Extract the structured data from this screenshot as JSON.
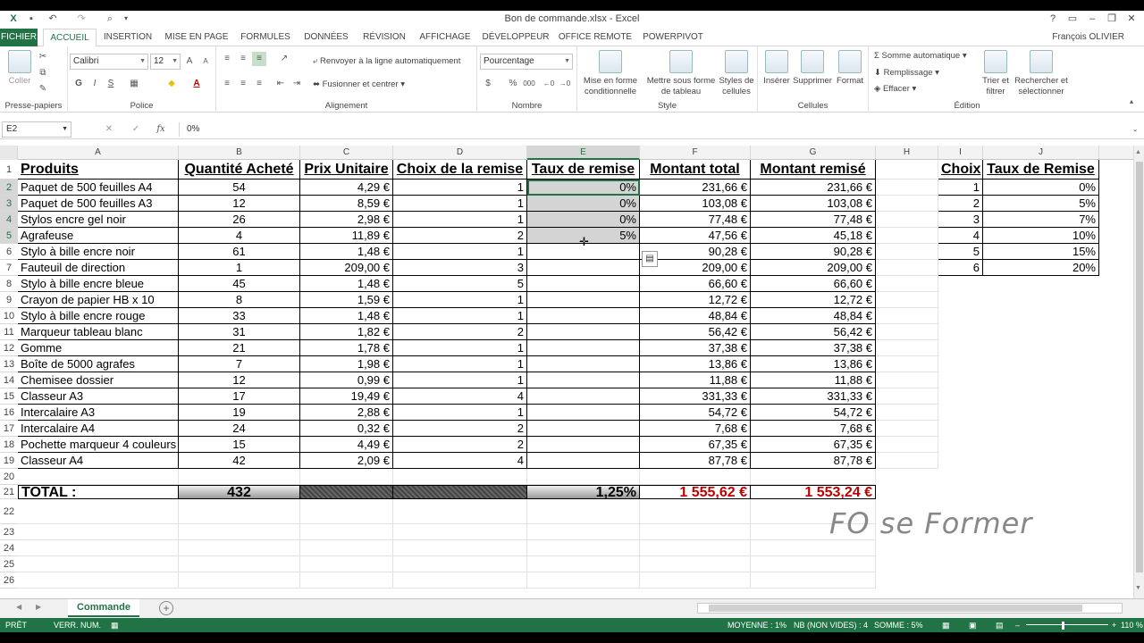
{
  "window": {
    "title": "Bon de commande.xlsx - Excel",
    "user": "François OLIVIER"
  },
  "tabs": [
    "FICHIER",
    "ACCUEIL",
    "INSERTION",
    "MISE EN PAGE",
    "FORMULES",
    "DONNÉES",
    "RÉVISION",
    "AFFICHAGE",
    "DÉVELOPPEUR",
    "OFFICE REMOTE",
    "POWERPIVOT"
  ],
  "ribbon": {
    "clipboard": {
      "label": "Presse-papiers",
      "paste": "Coller"
    },
    "font": {
      "label": "Police",
      "name": "Calibri",
      "size": "12",
      "bold": "G",
      "italic": "I",
      "underline": "S"
    },
    "align": {
      "label": "Alignement",
      "wrap": "Renvoyer à la ligne automatiquement",
      "merge": "Fusionner et centrer"
    },
    "number": {
      "label": "Nombre",
      "format": "Pourcentage",
      "percent": "%",
      "thousands": "000"
    },
    "style": {
      "label": "Style",
      "cond": "Mise en forme conditionnelle",
      "table": "Mettre sous forme de tableau",
      "cellstyles": "Styles de cellules"
    },
    "cells": {
      "label": "Cellules",
      "insert": "Insérer",
      "delete": "Supprimer",
      "format": "Format"
    },
    "edit": {
      "label": "Édition",
      "autosum": "Somme automatique",
      "fill": "Remplissage",
      "clear": "Effacer",
      "sort": "Trier et filtrer",
      "find": "Rechercher et sélectionner"
    }
  },
  "formula_bar": {
    "name_box": "E2",
    "fx": "fx",
    "value": "0%"
  },
  "columns": [
    "A",
    "B",
    "C",
    "D",
    "E",
    "F",
    "G",
    "H",
    "I",
    "J"
  ],
  "headers": {
    "A": "Produits",
    "B": "Quantité Acheté",
    "C": "Prix Unitaire",
    "D": "Choix de la remise",
    "E": "Taux de remise",
    "F": "Montant total",
    "G": "Montant remisé",
    "I": "Choix",
    "J": "Taux de Remise"
  },
  "rows": [
    [
      "Paquet de 500 feuilles A4",
      "54",
      "4,29 €",
      "1",
      "0%",
      "231,66 €",
      "231,66 €"
    ],
    [
      "Paquet de 500 feuilles A3",
      "12",
      "8,59 €",
      "1",
      "0%",
      "103,08 €",
      "103,08 €"
    ],
    [
      "Stylos encre gel noir",
      "26",
      "2,98 €",
      "1",
      "0%",
      "77,48 €",
      "77,48 €"
    ],
    [
      "Agrafeuse",
      "4",
      "11,89 €",
      "2",
      "5%",
      "47,56 €",
      "45,18 €"
    ],
    [
      "Stylo à bille encre noir",
      "61",
      "1,48 €",
      "1",
      "",
      "90,28 €",
      "90,28 €"
    ],
    [
      "Fauteuil de direction",
      "1",
      "209,00 €",
      "3",
      "",
      "209,00 €",
      "209,00 €"
    ],
    [
      "Stylo à bille encre bleue",
      "45",
      "1,48 €",
      "5",
      "",
      "66,60 €",
      "66,60 €"
    ],
    [
      "Crayon de papier HB x 10",
      "8",
      "1,59 €",
      "1",
      "",
      "12,72 €",
      "12,72 €"
    ],
    [
      "Stylo à bille encre rouge",
      "33",
      "1,48 €",
      "1",
      "",
      "48,84 €",
      "48,84 €"
    ],
    [
      "Marqueur tableau blanc",
      "31",
      "1,82 €",
      "2",
      "",
      "56,42 €",
      "56,42 €"
    ],
    [
      "Gomme",
      "21",
      "1,78 €",
      "1",
      "",
      "37,38 €",
      "37,38 €"
    ],
    [
      "Boîte de 5000 agrafes",
      "7",
      "1,98 €",
      "1",
      "",
      "13,86 €",
      "13,86 €"
    ],
    [
      "Chemisee dossier",
      "12",
      "0,99 €",
      "1",
      "",
      "11,88 €",
      "11,88 €"
    ],
    [
      "Classeur A3",
      "17",
      "19,49 €",
      "4",
      "",
      "331,33 €",
      "331,33 €"
    ],
    [
      "Intercalaire A3",
      "19",
      "2,88 €",
      "1",
      "",
      "54,72 €",
      "54,72 €"
    ],
    [
      "Intercalaire A4",
      "24",
      "0,32 €",
      "2",
      "",
      "7,68 €",
      "7,68 €"
    ],
    [
      "Pochette marqueur 4 couleurs",
      "15",
      "4,49 €",
      "2",
      "",
      "67,35 €",
      "67,35 €"
    ],
    [
      "Classeur A4",
      "42",
      "2,09 €",
      "4",
      "",
      "87,78 €",
      "87,78 €"
    ]
  ],
  "lookup": [
    [
      "1",
      "0%"
    ],
    [
      "2",
      "5%"
    ],
    [
      "3",
      "7%"
    ],
    [
      "4",
      "10%"
    ],
    [
      "5",
      "15%"
    ],
    [
      "6",
      "20%"
    ]
  ],
  "total": {
    "label": "TOTAL :",
    "qty": "432",
    "rate": "1,25%",
    "amount": "1 555,62 €",
    "discounted": "1 553,24 €"
  },
  "row_numbers": [
    "1",
    "2",
    "3",
    "4",
    "5",
    "6",
    "7",
    "8",
    "9",
    "10",
    "11",
    "12",
    "13",
    "14",
    "15",
    "16",
    "17",
    "18",
    "19",
    "20",
    "21",
    "22",
    "23",
    "24",
    "25",
    "26"
  ],
  "watermark": "FO se Former",
  "sheet_tab": "Commande",
  "status": {
    "ready": "PRÊT",
    "numlock": "VERR. NUM.",
    "average": "MOYENNE : 1%",
    "count": "NB (NON VIDES) : 4",
    "sum": "SOMME : 5%",
    "zoom": "110 %"
  },
  "colors": {
    "accent": "#217346",
    "total_red": "#c00000"
  }
}
